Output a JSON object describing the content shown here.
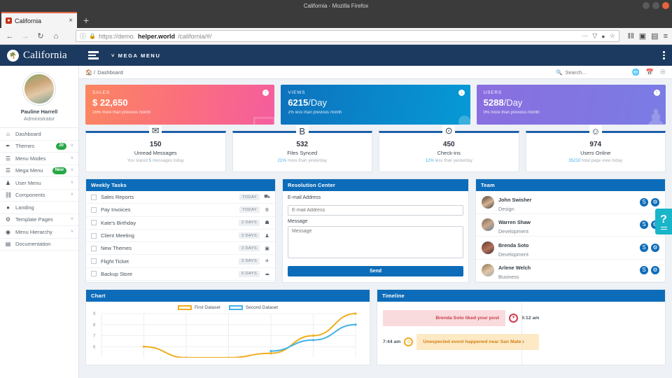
{
  "browser": {
    "window_title": "California - Mozilla Firefox",
    "tab_title": "California",
    "tab_favicon": "firefox-icon",
    "new_tab_label": "+",
    "close_tab_label": "×",
    "back_icon": "←",
    "forward_icon": "→",
    "reload_icon": "↻",
    "home_icon": "⌂",
    "info_icon": "ⓘ",
    "lock_icon": "🔒",
    "url_prefix": "https://demo.",
    "url_domain": "helper.world",
    "url_path": "/california/#/",
    "toolbar_menu_icon": "⋯",
    "pocket_icon": "▽",
    "shield_icon": "●",
    "star_icon": "☆",
    "library_icon": "‖‖",
    "sidebar_icon": "▣",
    "account_icon": "▤",
    "menu_icon": "≡"
  },
  "appbar": {
    "brand_name": "California",
    "brand_logo": "palm-tree-icon",
    "burger_label": "menu-toggle",
    "mega_menu_label": "MEGA MENU",
    "mega_menu_caret": "˅",
    "kebab_label": "more-options"
  },
  "sidebar": {
    "profile": {
      "name": "Pauline Harrell",
      "role": "Administrator",
      "avatar": "user-avatar"
    },
    "items": [
      {
        "label": "Dashboard",
        "icon": "home-icon",
        "badge": null,
        "caret": false
      },
      {
        "label": "Themes",
        "icon": "brush-icon",
        "badge": "20",
        "caret": true
      },
      {
        "label": "Menu Modes",
        "icon": "list-icon",
        "badge": null,
        "caret": true
      },
      {
        "label": "Mega Menu",
        "icon": "list-icon",
        "badge": "New",
        "caret": true
      },
      {
        "label": "User Menu",
        "icon": "user-icon",
        "badge": null,
        "caret": true
      },
      {
        "label": "Components",
        "icon": "sitemap-icon",
        "badge": null,
        "caret": true
      },
      {
        "label": "Landing",
        "icon": "circle-icon",
        "badge": null,
        "caret": false
      },
      {
        "label": "Template Pages",
        "icon": "gear-icon",
        "badge": null,
        "caret": true
      },
      {
        "label": "Menu Hierarchy",
        "icon": "eye-icon",
        "badge": null,
        "caret": true
      },
      {
        "label": "Documentation",
        "icon": "book-icon",
        "badge": null,
        "caret": false
      }
    ],
    "badge_color": "#27a745"
  },
  "breadcrumb": {
    "home_icon": "home-icon",
    "separator": "/",
    "current": "Dashboard",
    "search_placeholder": "Search...",
    "search_value": "",
    "search_icon": "search-icon",
    "icons": [
      "globe-icon",
      "calendar-icon",
      "language-icon"
    ]
  },
  "stats": [
    {
      "label": "SALES",
      "value": "$ 22,650",
      "unit": "",
      "sub": "16% more than previous month",
      "arrow": "↑",
      "deco": "wallet-icon",
      "color": "#fb6f7c"
    },
    {
      "label": "VIEWS",
      "value": "6215",
      "unit": "/Day",
      "sub": "2% less than previous month",
      "arrow": "↓",
      "deco": "circle-icon",
      "color": "#069ad6"
    },
    {
      "label": "USERS",
      "value": "5288",
      "unit": "/Day",
      "sub": "9% more than previous month",
      "arrow": "↑",
      "deco": "users-icon",
      "color": "#7a7ce4"
    }
  ],
  "metrics": [
    {
      "number": "150",
      "title": "Unread Messages",
      "sub_pre": "You stared ",
      "sub_hl": "5",
      "sub_post": " messages today",
      "icon": "envelope-icon"
    },
    {
      "number": "532",
      "title": "Files Synced",
      "sub_pre": "",
      "sub_hl": "21%",
      "sub_post": " more than yesterday",
      "icon": "file-icon"
    },
    {
      "number": "450",
      "title": "Check-ins",
      "sub_pre": "",
      "sub_hl": "12%",
      "sub_post": " less than yesterday",
      "icon": "map-pin-icon"
    },
    {
      "number": "974",
      "title": "Users Online",
      "sub_pre": "",
      "sub_hl": "35210",
      "sub_post": " total page view today",
      "icon": "user-circle-icon"
    }
  ],
  "tasks_panel": {
    "title": "Weekly Tasks",
    "items": [
      {
        "label": "Sales Reports",
        "due": "TODAY",
        "icon": "cart-icon",
        "checked": false
      },
      {
        "label": "Pay Invoices",
        "due": "TODAY",
        "icon": "file-icon",
        "checked": false
      },
      {
        "label": "Kate's Birthday",
        "due": "2 DAYS",
        "icon": "cake-icon",
        "checked": false
      },
      {
        "label": "Client Meeting",
        "due": "3 DAYS",
        "icon": "users-icon",
        "checked": false
      },
      {
        "label": "New Themes",
        "due": "3 DAYS",
        "icon": "image-icon",
        "checked": false
      },
      {
        "label": "Flight Ticket",
        "due": "3 DAYS",
        "icon": "plane-icon",
        "checked": false
      },
      {
        "label": "Backup Store",
        "due": "5 DAYS",
        "icon": "cloud-icon",
        "checked": false
      }
    ]
  },
  "resolution_panel": {
    "title": "Resolution Center",
    "email_label": "E-mail Address",
    "email_placeholder": "E-mail Address",
    "email_value": "",
    "message_label": "Message",
    "message_placeholder": "Message",
    "message_value": "",
    "send_label": "Send"
  },
  "team_panel": {
    "title": "Team",
    "members": [
      {
        "name": "John Swisher",
        "role": "Design",
        "icons": [
          "skype-icon",
          "gear-icon"
        ]
      },
      {
        "name": "Warren Shaw",
        "role": "Development",
        "icons": [
          "skype-icon",
          "gear-icon"
        ]
      },
      {
        "name": "Brenda Soto",
        "role": "Development",
        "icons": [
          "skype-icon",
          "gear-icon"
        ]
      },
      {
        "name": "Arlene Welch",
        "role": "Business",
        "icons": [
          "skype-icon",
          "gear-icon"
        ]
      }
    ]
  },
  "chart_panel": {
    "title": "Chart"
  },
  "chart_data": {
    "type": "line",
    "title": "Chart",
    "xlabel": "",
    "ylabel": "",
    "ylim": [
      5,
      9
    ],
    "yticks": [
      6,
      7,
      8,
      9
    ],
    "grid": true,
    "legend_position": "top-center",
    "x": [
      1,
      2,
      3,
      4,
      5,
      6,
      7
    ],
    "series": [
      {
        "name": "First Dataset",
        "color": "#f0ad1e",
        "values": [
          null,
          6,
          5,
          5,
          5.4,
          7,
          9
        ]
      },
      {
        "name": "Second Dataset",
        "color": "#41b3e8",
        "values": [
          null,
          null,
          null,
          null,
          5.6,
          6.6,
          8
        ]
      }
    ]
  },
  "timeline_panel": {
    "title": "Timeline",
    "events": [
      {
        "side": "left",
        "text": "Brenda Soto liked your post",
        "time": "6:12 am",
        "icon": "heart-icon",
        "color": "#d13b4a"
      },
      {
        "side": "right",
        "text": "Unexpected event happened near San Mateo",
        "time": "7:44 am",
        "icon": "bulb-icon",
        "color": "#f0ad1e"
      }
    ]
  },
  "help_widget": {
    "label": "?",
    "name": "help-button"
  }
}
